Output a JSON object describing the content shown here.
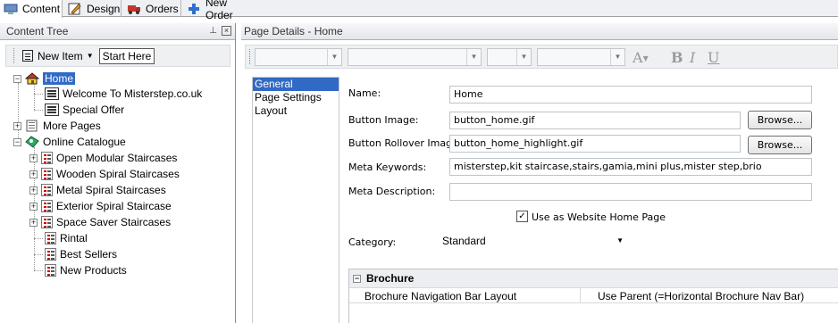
{
  "tabs": [
    {
      "label": "Content",
      "icon": "content-icon"
    },
    {
      "label": "Design",
      "icon": "design-icon"
    },
    {
      "label": "Orders",
      "icon": "orders-icon"
    },
    {
      "label": "New Order",
      "icon": "plus-icon"
    }
  ],
  "content_tree": {
    "title": "Content Tree",
    "new_item_label": "New Item",
    "start_here_label": "Start Here",
    "nodes": [
      {
        "label": "Home",
        "icon": "home-icon",
        "expanded": true,
        "selected": true
      },
      {
        "label": "Welcome To Misterstep.co.uk",
        "icon": "page-icon"
      },
      {
        "label": "Special Offer",
        "icon": "page-icon"
      },
      {
        "label": "More Pages",
        "icon": "folder-icon",
        "expanded": false
      },
      {
        "label": "Online Catalogue",
        "icon": "catalogue-icon",
        "expanded": true
      },
      {
        "label": "Open Modular Staircases",
        "icon": "category-icon",
        "expanded": false
      },
      {
        "label": "Wooden Spiral Staircases",
        "icon": "category-icon",
        "expanded": false
      },
      {
        "label": "Metal Spiral Staircases",
        "icon": "category-icon",
        "expanded": false
      },
      {
        "label": "Exterior Spiral Staircase",
        "icon": "category-icon",
        "expanded": false
      },
      {
        "label": "Space Saver Staircases",
        "icon": "category-icon",
        "expanded": false
      },
      {
        "label": "Rintal",
        "icon": "category-icon"
      },
      {
        "label": "Best Sellers",
        "icon": "category-icon"
      },
      {
        "label": "New Products",
        "icon": "category-icon"
      }
    ]
  },
  "page_details": {
    "title": "Page Details - Home",
    "side_items": [
      "General",
      "Page Settings",
      "Layout"
    ],
    "active_side_item": "General",
    "format_buttons": [
      "A",
      "B",
      "I",
      "U"
    ],
    "name_label": "Name:",
    "name_value": "Home",
    "button_image_label": "Button Image:",
    "button_image_value": "button_home.gif",
    "rollover_label": "Button Rollover Image:",
    "rollover_value": "button_home_highlight.gif",
    "browse_label": "Browse...",
    "meta_keywords_label": "Meta Keywords:",
    "meta_keywords_value": "misterstep,kit staircase,stairs,gamia,mini plus,mister step,brio",
    "meta_description_label": "Meta Description:",
    "meta_description_value": "",
    "home_page_checkbox_label": "Use as Website Home Page",
    "home_page_checked": true,
    "category_label": "Category:",
    "category_value": "Standard",
    "brochure": {
      "section_title": "Brochure",
      "row_label": "Brochure Navigation Bar Layout",
      "row_value": "Use Parent (=Horizontal Brochure Nav Bar)"
    }
  },
  "colors": {
    "selection": "#316ac5",
    "pane_header": "#e3e6ea"
  }
}
